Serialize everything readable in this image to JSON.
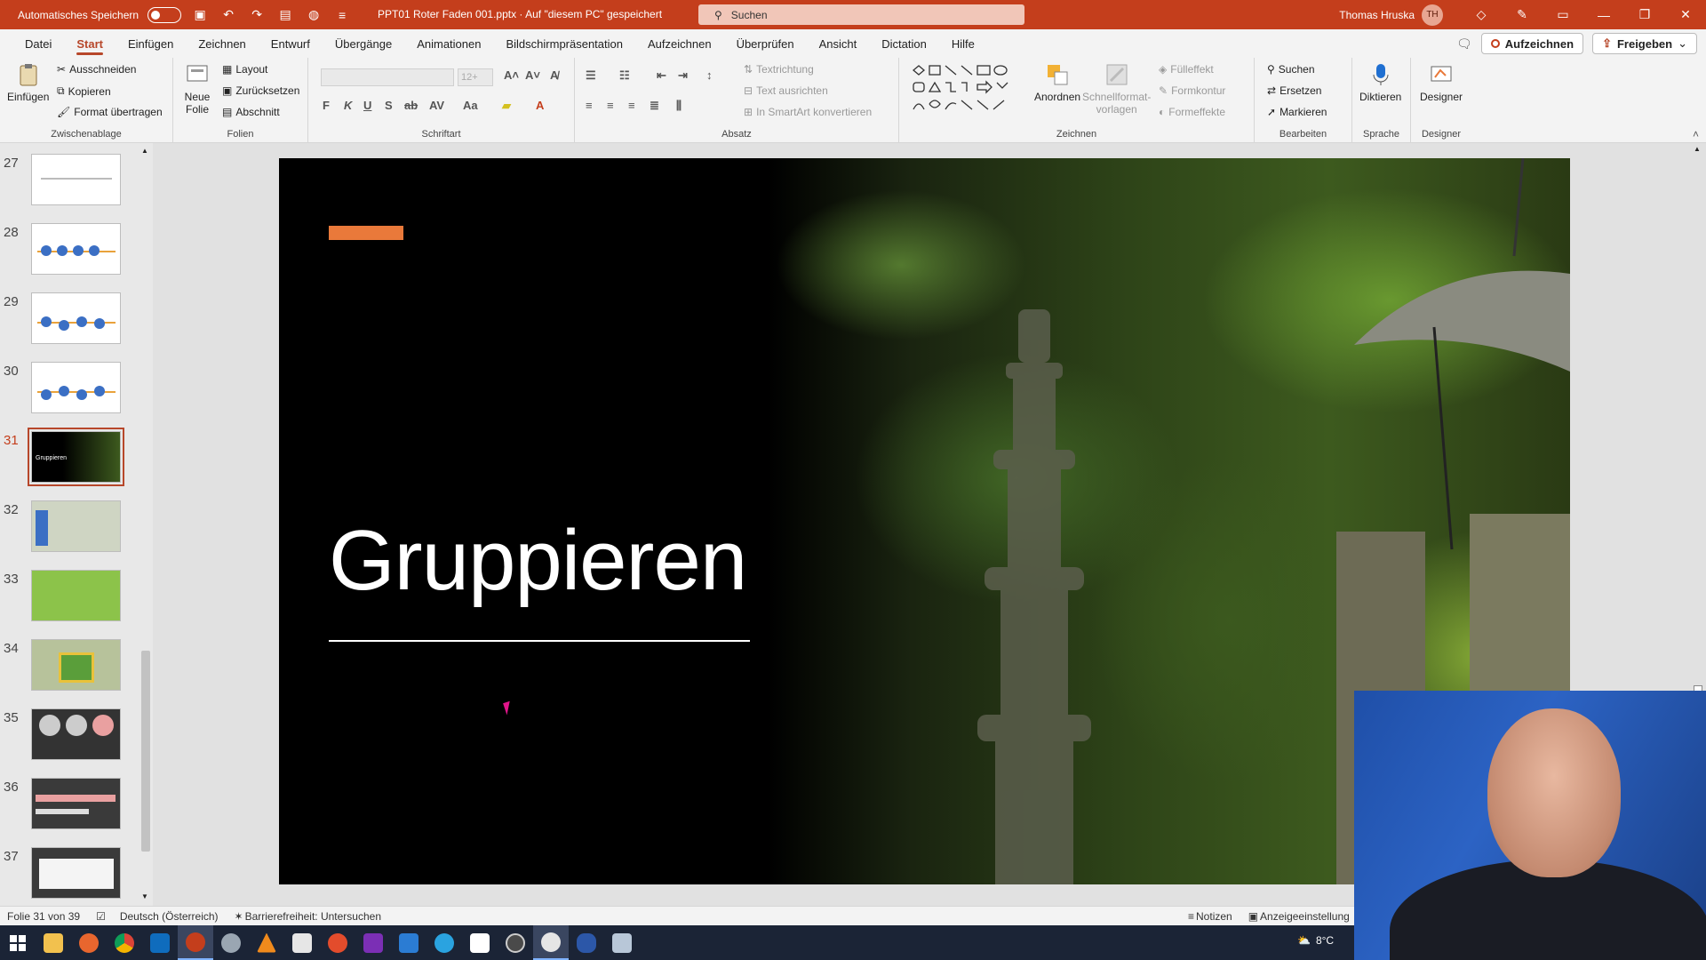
{
  "titlebar": {
    "autosave_label": "Automatisches Speichern",
    "doc_title": "PPT01 Roter Faden 001.pptx · Auf \"diesem PC\" gespeichert",
    "search_label": "Suchen",
    "user_name": "Thomas Hruska",
    "user_initials": "TH"
  },
  "menu": {
    "tabs": [
      "Datei",
      "Start",
      "Einfügen",
      "Zeichnen",
      "Entwurf",
      "Übergänge",
      "Animationen",
      "Bildschirmpräsentation",
      "Aufzeichnen",
      "Überprüfen",
      "Ansicht",
      "Dictation",
      "Hilfe"
    ],
    "active_tab": "Start",
    "record_label": "Aufzeichnen",
    "share_label": "Freigeben"
  },
  "ribbon": {
    "clipboard": {
      "paste": "Einfügen",
      "cut": "Ausschneiden",
      "copy": "Kopieren",
      "format_painter": "Format übertragen",
      "label": "Zwischenablage"
    },
    "slides": {
      "new_slide_1": "Neue",
      "new_slide_2": "Folie",
      "layout": "Layout",
      "reset": "Zurücksetzen",
      "section": "Abschnitt",
      "label": "Folien"
    },
    "font": {
      "size": "12+",
      "label": "Schriftart"
    },
    "paragraph": {
      "text_direction": "Textrichtung",
      "align_text": "Text ausrichten",
      "smartart": "In SmartArt konvertieren",
      "label": "Absatz"
    },
    "drawing": {
      "arrange": "Anordnen",
      "quick_styles_1": "Schnellformat-",
      "quick_styles_2": "vorlagen",
      "fill": "Fülleffekt",
      "outline": "Formkontur",
      "effects": "Formeffekte",
      "label": "Zeichnen"
    },
    "editing": {
      "find": "Suchen",
      "replace": "Ersetzen",
      "select": "Markieren",
      "label": "Bearbeiten"
    },
    "voice": {
      "dictate": "Diktieren",
      "label": "Sprache"
    },
    "designer": {
      "button": "Designer",
      "label": "Designer"
    }
  },
  "slides": [
    {
      "num": "27"
    },
    {
      "num": "28"
    },
    {
      "num": "29"
    },
    {
      "num": "30"
    },
    {
      "num": "31",
      "caption": "Gruppieren"
    },
    {
      "num": "32"
    },
    {
      "num": "33"
    },
    {
      "num": "34"
    },
    {
      "num": "35"
    },
    {
      "num": "36"
    },
    {
      "num": "37"
    }
  ],
  "active_slide": "31",
  "slide_content": {
    "title": "Gruppieren",
    "accent_color": "#e9793a"
  },
  "statusbar": {
    "slide_count": "Folie 31 von 39",
    "language": "Deutsch (Österreich)",
    "accessibility": "Barrierefreiheit: Untersuchen",
    "notes": "Notizen",
    "display_settings": "Anzeigeeinstellung"
  },
  "taskbar": {
    "temperature": "8°C"
  },
  "colors": {
    "brand": "#c43e1c",
    "active_tab": "#b7472a"
  }
}
